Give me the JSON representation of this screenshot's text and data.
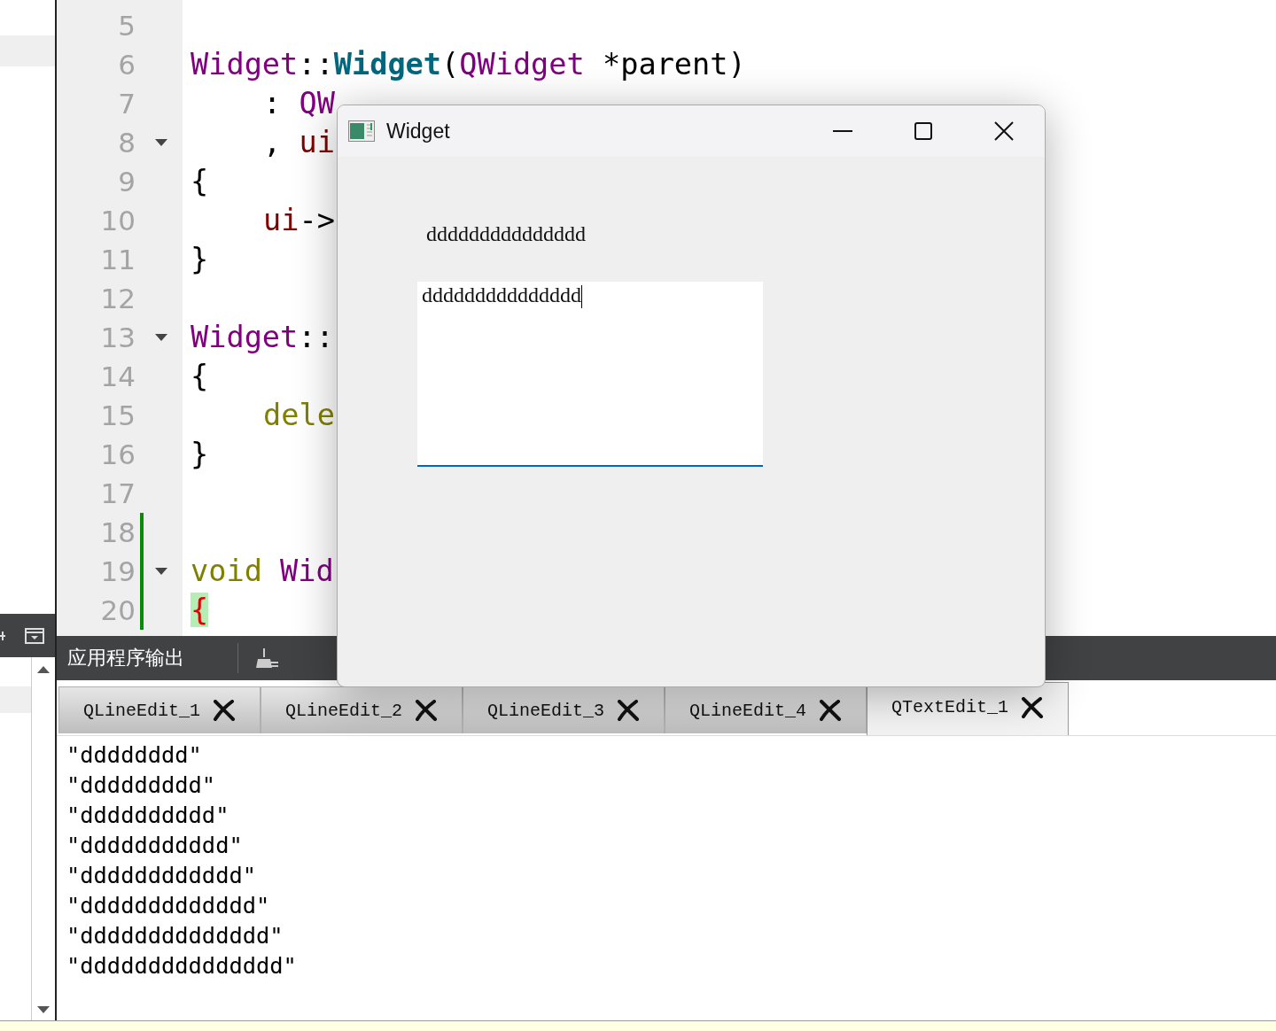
{
  "editor": {
    "lines": [
      {
        "number": "5",
        "fold": false,
        "changed": false
      },
      {
        "number": "6",
        "fold": false,
        "changed": false,
        "tokens": [
          {
            "text": "Widget",
            "kind": "type"
          },
          {
            "text": "::",
            "kind": "plain"
          },
          {
            "text": "Widget",
            "kind": "func"
          },
          {
            "text": "(",
            "kind": "plain"
          },
          {
            "text": "QWidget",
            "kind": "type"
          },
          {
            "text": " *parent)",
            "kind": "plain"
          }
        ]
      },
      {
        "number": "7",
        "fold": false,
        "changed": false,
        "tokens": [
          {
            "text": ": ",
            "kind": "plain"
          },
          {
            "text": "QW",
            "kind": "type"
          }
        ],
        "indent": true
      },
      {
        "number": "8",
        "fold": true,
        "changed": false,
        "tokens": [
          {
            "text": ", ",
            "kind": "plain"
          },
          {
            "text": "ui",
            "kind": "member"
          }
        ],
        "indent": true
      },
      {
        "number": "9",
        "fold": false,
        "changed": false,
        "tokens": [
          {
            "text": "{",
            "kind": "plain"
          }
        ]
      },
      {
        "number": "10",
        "fold": false,
        "changed": false,
        "tokens": [
          {
            "text": "ui",
            "kind": "member"
          },
          {
            "text": "->",
            "kind": "plain"
          }
        ],
        "indent": true
      },
      {
        "number": "11",
        "fold": false,
        "changed": false,
        "tokens": [
          {
            "text": "}",
            "kind": "plain"
          }
        ]
      },
      {
        "number": "12",
        "fold": false,
        "changed": false
      },
      {
        "number": "13",
        "fold": true,
        "changed": false,
        "tokens": [
          {
            "text": "Widget",
            "kind": "type"
          },
          {
            "text": "::",
            "kind": "plain"
          }
        ]
      },
      {
        "number": "14",
        "fold": false,
        "changed": false,
        "tokens": [
          {
            "text": "{",
            "kind": "plain"
          }
        ]
      },
      {
        "number": "15",
        "fold": false,
        "changed": false,
        "tokens": [
          {
            "text": "dele",
            "kind": "keyword"
          }
        ],
        "indent": true
      },
      {
        "number": "16",
        "fold": false,
        "changed": false,
        "tokens": [
          {
            "text": "}",
            "kind": "plain"
          }
        ]
      },
      {
        "number": "17",
        "fold": false,
        "changed": false
      },
      {
        "number": "18",
        "fold": false,
        "changed": true
      },
      {
        "number": "19",
        "fold": true,
        "changed": true,
        "tokens": [
          {
            "text": "void",
            "kind": "keyword"
          },
          {
            "text": " Wid",
            "kind": "type"
          }
        ]
      },
      {
        "number": "20",
        "fold": false,
        "changed": true,
        "tokens": [
          {
            "text": "{",
            "kind": "brace-match"
          }
        ]
      }
    ]
  },
  "output_pane": {
    "title": "应用程序输出",
    "tabs": [
      {
        "label": "QLineEdit_1",
        "selected": false
      },
      {
        "label": "QLineEdit_2",
        "selected": false
      },
      {
        "label": "QLineEdit_3",
        "selected": false
      },
      {
        "label": "QLineEdit_4",
        "selected": false
      },
      {
        "label": "QTextEdit_1",
        "selected": true
      }
    ],
    "lines": [
      "\"dddddddd\"",
      "\"ddddddddd\"",
      "\"dddddddddd\"",
      "\"ddddddddddd\"",
      "\"dddddddddddd\"",
      "\"ddddddddddddd\"",
      "\"dddddddddddddd\"",
      "\"ddddddddddddddd\""
    ]
  },
  "dialog": {
    "title": "Widget",
    "label": "ddddddddddddddd",
    "text_edit": {
      "value": "ddddddddddddddd",
      "focused": true
    }
  }
}
